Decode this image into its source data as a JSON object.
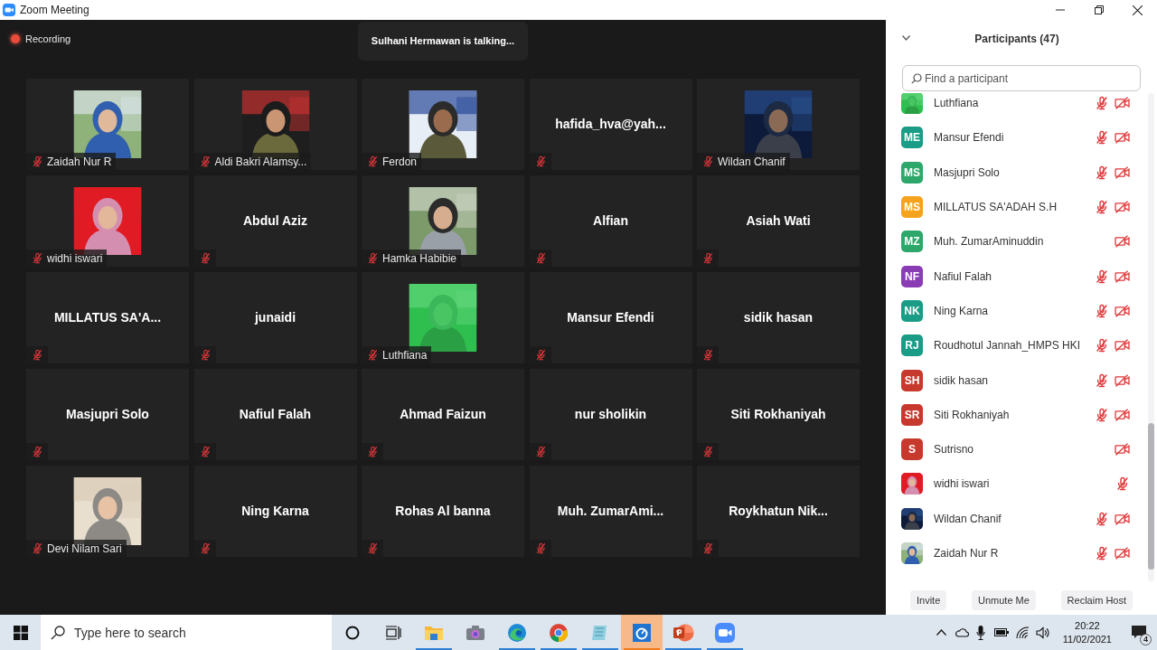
{
  "window": {
    "title": "Zoom Meeting"
  },
  "meeting": {
    "recording": "Recording",
    "talking": "Sulhani Hermawan is talking..."
  },
  "tiles": [
    {
      "kind": "video",
      "name": "Zaidah Nur R",
      "muted": true
    },
    {
      "kind": "video",
      "name": "Aldi Bakri Alamsy...",
      "muted": true
    },
    {
      "kind": "video",
      "name": "Ferdon",
      "muted": true
    },
    {
      "kind": "name",
      "name": "hafida_hva@yah...",
      "muted": true
    },
    {
      "kind": "video",
      "name": "Wildan Chanif",
      "muted": true
    },
    {
      "kind": "video",
      "name": "widhi iswari",
      "muted": true
    },
    {
      "kind": "name",
      "name": "Abdul Aziz",
      "muted": true
    },
    {
      "kind": "video",
      "name": "Hamka Habibie",
      "muted": true
    },
    {
      "kind": "name",
      "name": "Alfian",
      "muted": true
    },
    {
      "kind": "name",
      "name": "Asiah Wati",
      "muted": true
    },
    {
      "kind": "name",
      "name": "MILLATUS SA'A...",
      "muted": true
    },
    {
      "kind": "name",
      "name": "junaidi",
      "muted": true
    },
    {
      "kind": "video",
      "name": "Luthfiana",
      "muted": true
    },
    {
      "kind": "name",
      "name": "Mansur Efendi",
      "muted": true
    },
    {
      "kind": "name",
      "name": "sidik hasan",
      "muted": true
    },
    {
      "kind": "name",
      "name": "Masjupri Solo",
      "muted": true
    },
    {
      "kind": "name",
      "name": "Nafiul Falah",
      "muted": true
    },
    {
      "kind": "name",
      "name": "Ahmad Faizun",
      "muted": true
    },
    {
      "kind": "name",
      "name": "nur sholikin",
      "muted": true
    },
    {
      "kind": "name",
      "name": "Siti Rokhaniyah",
      "muted": true
    },
    {
      "kind": "video",
      "name": "Devi Nilam Sari",
      "muted": true
    },
    {
      "kind": "name",
      "name": "Ning Karna",
      "muted": true
    },
    {
      "kind": "name",
      "name": "Rohas Al banna",
      "muted": true
    },
    {
      "kind": "name",
      "name": "Muh. ZumarAmi...",
      "muted": true
    },
    {
      "kind": "name",
      "name": "Roykhatun Nik...",
      "muted": true
    }
  ],
  "participants_panel": {
    "title": "Participants (47)",
    "search": {
      "placeholder": "Find a participant"
    },
    "participants": [
      {
        "kind": "picture",
        "name": "Luthfiana",
        "mic_muted": true,
        "video_off": true
      },
      {
        "kind": "initials",
        "initials": "ME",
        "color": "#1a9c86",
        "name": "Mansur Efendi",
        "mic_muted": true,
        "video_off": true
      },
      {
        "kind": "initials",
        "initials": "MS",
        "color": "#2ea86a",
        "name": "Masjupri Solo",
        "mic_muted": true,
        "video_off": true
      },
      {
        "kind": "initials",
        "initials": "MS",
        "color": "#f5a21c",
        "name": "MILLATUS SA'ADAH S.H",
        "mic_muted": true,
        "video_off": true
      },
      {
        "kind": "initials",
        "initials": "MZ",
        "color": "#2ea86a",
        "name": "Muh. ZumarAminuddin",
        "mic_muted": false,
        "video_off": true
      },
      {
        "kind": "initials",
        "initials": "NF",
        "color": "#8a3cb5",
        "name": "Nafiul Falah",
        "mic_muted": true,
        "video_off": true
      },
      {
        "kind": "initials",
        "initials": "NK",
        "color": "#1a9c86",
        "name": "Ning Karna",
        "mic_muted": true,
        "video_off": true
      },
      {
        "kind": "initials",
        "initials": "RJ",
        "color": "#1a9c86",
        "name": "Roudhotul Jannah_HMPS HKI",
        "mic_muted": true,
        "video_off": true
      },
      {
        "kind": "initials",
        "initials": "SH",
        "color": "#c8392d",
        "name": "sidik hasan",
        "mic_muted": true,
        "video_off": true
      },
      {
        "kind": "initials",
        "initials": "SR",
        "color": "#c8392d",
        "name": "Siti Rokhaniyah",
        "mic_muted": true,
        "video_off": true
      },
      {
        "kind": "initials",
        "initials": "S",
        "color": "#c8392d",
        "name": "Sutrisno",
        "mic_muted": false,
        "video_off": true
      },
      {
        "kind": "picture",
        "name": "widhi iswari",
        "mic_muted": true,
        "video_off": false
      },
      {
        "kind": "picture",
        "name": "Wildan Chanif",
        "mic_muted": true,
        "video_off": true
      },
      {
        "kind": "picture",
        "name": "Zaidah Nur R",
        "mic_muted": true,
        "video_off": true
      }
    ],
    "buttons": [
      "Invite",
      "Unmute Me",
      "Reclaim Host"
    ]
  },
  "taskbar": {
    "search": {
      "placeholder": "Type here to search"
    },
    "apps": [
      {
        "kind": "folder",
        "running": true,
        "selected": false
      },
      {
        "kind": "camera",
        "running": false,
        "selected": false
      },
      {
        "kind": "edge",
        "running": true,
        "selected": false
      },
      {
        "kind": "chrome",
        "running": true,
        "selected": false
      },
      {
        "kind": "notepad",
        "running": true,
        "selected": false
      },
      {
        "kind": "gauge",
        "running": true,
        "selected": true
      },
      {
        "kind": "slides",
        "running": true,
        "selected": false
      },
      {
        "kind": "zoom",
        "running": true,
        "selected": false
      }
    ],
    "time": "20:22",
    "date": "11/02/2021",
    "notifications": "4"
  }
}
